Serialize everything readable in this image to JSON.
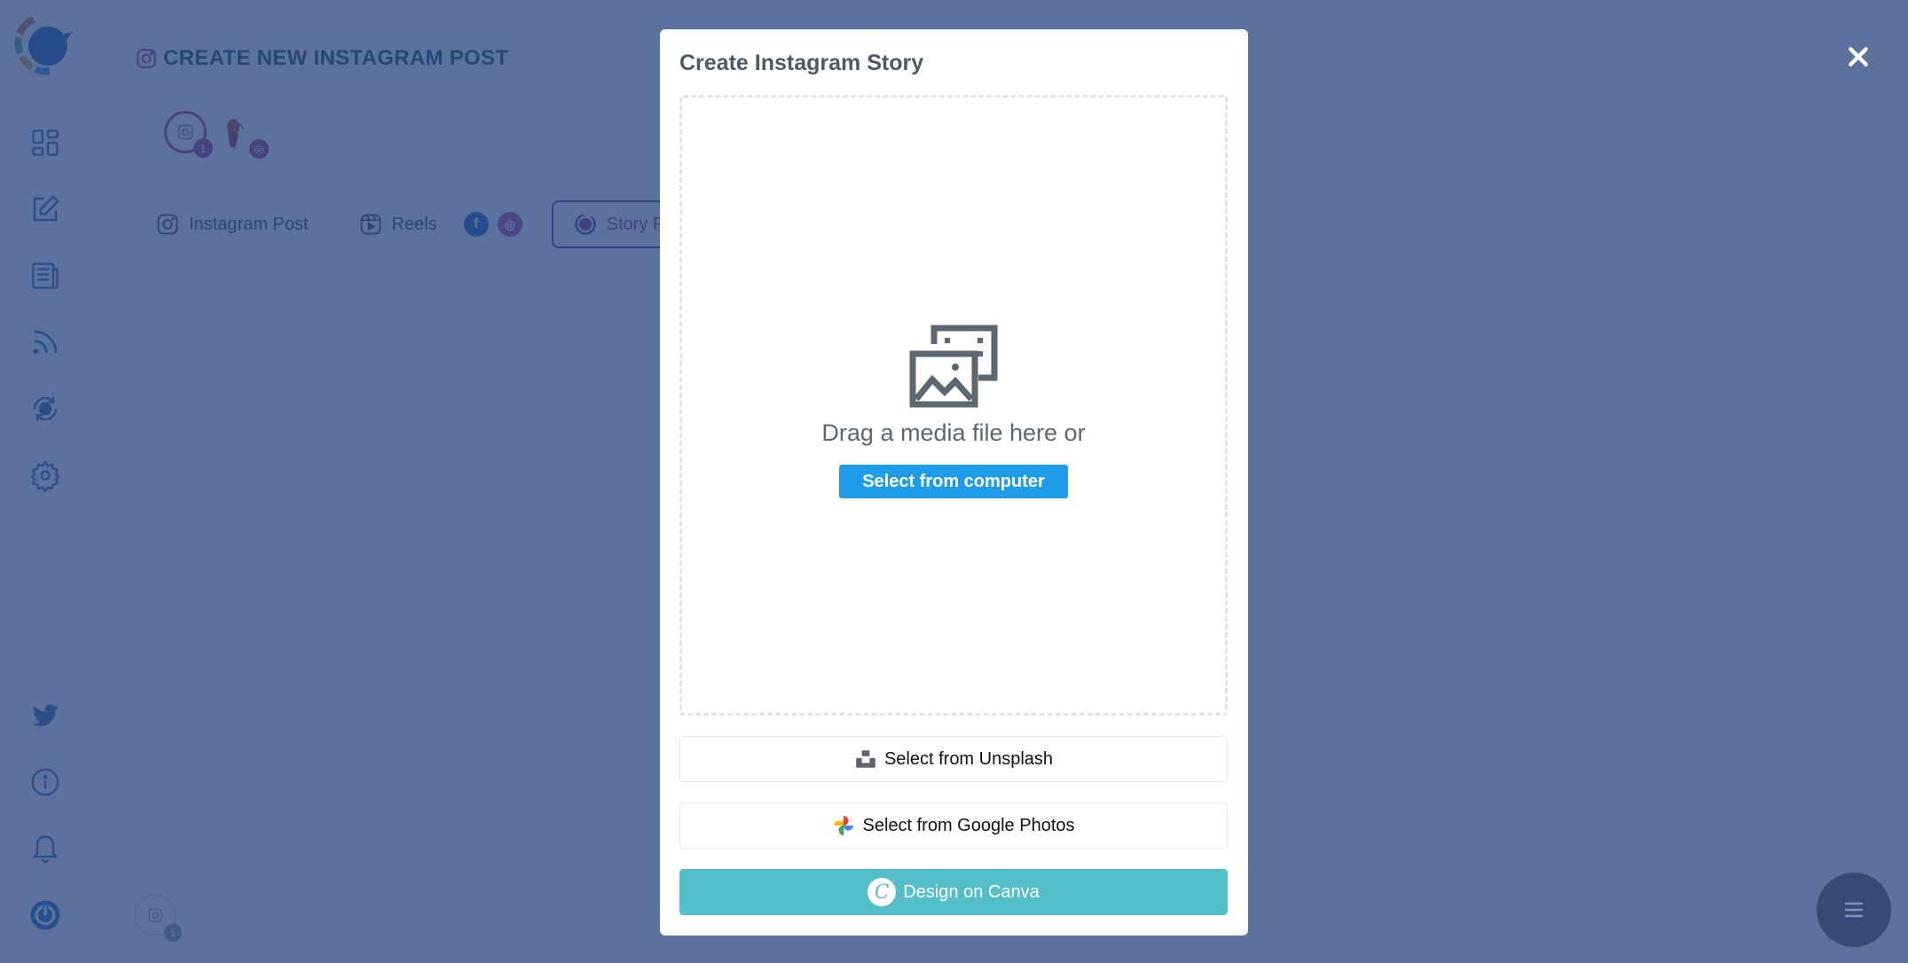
{
  "sidebar": {
    "items": [
      {
        "name": "dashboard",
        "icon": "grid-icon"
      },
      {
        "name": "compose",
        "icon": "edit-icon"
      },
      {
        "name": "posts",
        "icon": "newspaper-icon"
      },
      {
        "name": "rss",
        "icon": "rss-icon"
      },
      {
        "name": "schedule",
        "icon": "clock-refresh-icon"
      },
      {
        "name": "settings",
        "icon": "gear-icon"
      }
    ],
    "bottom_items": [
      {
        "name": "twitter",
        "icon": "twitter-icon"
      },
      {
        "name": "info",
        "icon": "info-icon"
      },
      {
        "name": "notifications",
        "icon": "bell-icon"
      },
      {
        "name": "power",
        "icon": "power-icon"
      }
    ]
  },
  "page": {
    "title": "CREATE NEW INSTAGRAM POST",
    "accounts": {
      "group_badge": "1"
    },
    "tabs": [
      {
        "label": "Instagram Post"
      },
      {
        "label": "Reels"
      },
      {
        "label": "Story Post"
      }
    ],
    "bottom_badge": "1"
  },
  "modal": {
    "title": "Create Instagram Story",
    "dropzone_text": "Drag a media file here or",
    "select_computer_label": "Select from computer",
    "unsplash_label": "Select from Unsplash",
    "google_photos_label": "Select from Google Photos",
    "canva_label": "Design on Canva",
    "canva_logo_letter": "C"
  },
  "colors": {
    "overlay": "#5E7298",
    "primary_button": "#1E9BE9",
    "canva": "#55BFC9",
    "instagram": "#A4327E"
  }
}
